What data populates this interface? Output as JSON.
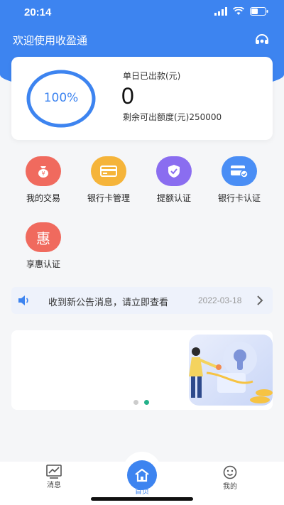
{
  "status_bar": {
    "time": "20:14"
  },
  "header": {
    "title": "欢迎使用收盈通",
    "support_icon": "headset-icon"
  },
  "summary": {
    "progress_text": "100%",
    "progress_fraction": 1.0,
    "single_day_label": "单日已出款(元)",
    "single_day_value": "0",
    "remaining_label": "剩余可出额度(元)250000"
  },
  "menu": {
    "items": [
      {
        "label": "我的交易",
        "icon": "money-bag-icon",
        "color": "#f06a5e"
      },
      {
        "label": "银行卡管理",
        "icon": "card-icon",
        "color": "#f5b43a"
      },
      {
        "label": "提额认证",
        "icon": "shield-check-icon",
        "color": "#8a6df0"
      },
      {
        "label": "银行卡认证",
        "icon": "card-verify-icon",
        "color": "#4a8ef5"
      },
      {
        "label": "享惠认证",
        "icon": "hui-icon",
        "icon_glyph": "惠",
        "color": "#f06a5e"
      }
    ]
  },
  "notice": {
    "text": "收到新公告消息，请立即查看",
    "date": "2022-03-18",
    "icon": "speaker-icon"
  },
  "banner": {
    "active_index": 1,
    "count": 2
  },
  "tabbar": {
    "tabs": [
      {
        "label": "消息",
        "icon": "chart-icon"
      },
      {
        "label": "首页",
        "icon": "home-icon",
        "active": true
      },
      {
        "label": "我的",
        "icon": "user-icon"
      }
    ]
  },
  "colors": {
    "primary": "#3d84f0",
    "dot_active": "#25b18a",
    "dot_inactive": "#cccccc"
  }
}
